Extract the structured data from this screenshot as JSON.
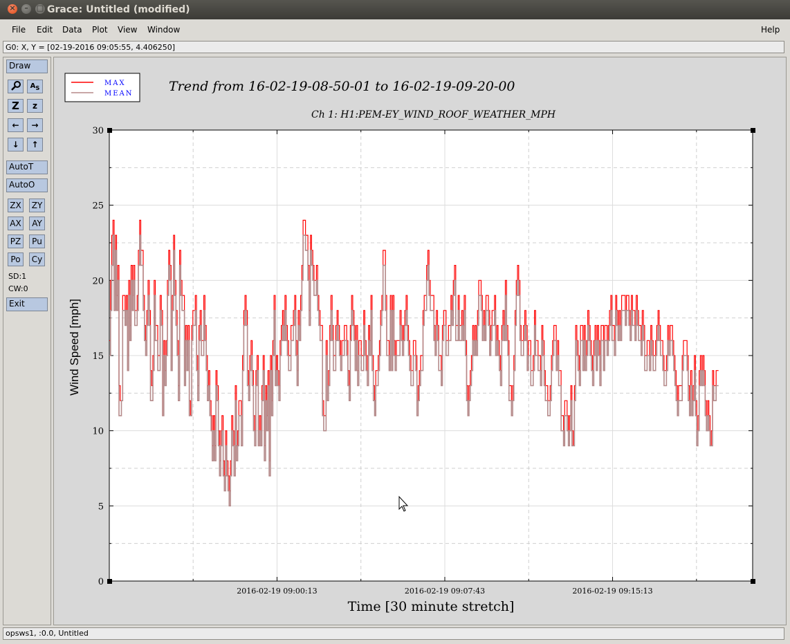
{
  "window": {
    "title": "Grace: Untitled (modified)"
  },
  "menubar": {
    "items": [
      "File",
      "Edit",
      "Data",
      "Plot",
      "View",
      "Window"
    ],
    "help": "Help"
  },
  "locator": {
    "text": "G0: X, Y = [02-19-2016 09:05:55, 4.406250]"
  },
  "toolbar": {
    "draw": "Draw",
    "autot": "AutoT",
    "autoo": "AutoO",
    "zx": "ZX",
    "zy": "ZY",
    "ax": "AX",
    "ay": "AY",
    "pz": "PZ",
    "pu": "Pu",
    "po": "Po",
    "cy": "Cy",
    "sd": "SD:1",
    "cw": "CW:0",
    "exit": "Exit"
  },
  "status": {
    "text": "opsws1, :0.0, Untitled"
  },
  "chart_data": {
    "type": "line",
    "title": "Trend from 16-02-19-08-50-01 to 16-02-19-09-20-00",
    "subtitle": "Ch 1: H1:PEM-EY_WIND_ROOF_WEATHER_MPH",
    "xlabel": "Time [30 minute stretch]",
    "ylabel": "Wind Speed [mph]",
    "ylim": [
      0,
      30
    ],
    "yticks": [
      0,
      5,
      10,
      15,
      20,
      25,
      30
    ],
    "xticks": [
      "2016-02-19 09:00:13",
      "2016-02-19 09:07:43",
      "2016-02-19 09:15:13"
    ],
    "grid": true,
    "legend": "top-left",
    "colors": {
      "max": "#ff0000",
      "mean": "#b58a8a"
    },
    "series": [
      {
        "name": "MAX",
        "values": [
          16,
          20,
          23,
          24,
          20,
          23,
          19,
          21,
          13,
          12,
          12,
          19,
          19,
          18,
          19,
          15,
          20,
          17,
          21,
          19,
          21,
          18,
          18,
          19,
          22,
          24,
          22,
          22,
          19,
          17,
          16,
          18,
          20,
          18,
          14,
          13,
          15,
          20,
          17,
          17,
          15,
          15,
          19,
          18,
          11,
          16,
          14,
          16,
          20,
          22,
          21,
          15,
          19,
          23,
          20,
          18,
          16,
          13,
          22,
          20,
          19,
          19,
          14,
          17,
          15,
          17,
          12,
          11,
          17,
          18,
          18,
          19,
          15,
          13,
          17,
          18,
          16,
          16,
          19,
          17,
          15,
          13,
          14,
          12,
          11,
          9,
          11,
          9,
          14,
          13,
          10,
          8,
          10,
          11,
          8,
          7,
          10,
          8,
          7,
          6,
          8,
          11,
          10,
          7,
          13,
          9,
          10,
          12,
          12,
          9,
          15,
          18,
          19,
          18,
          14,
          13,
          15,
          16,
          14,
          11,
          10,
          14,
          15,
          9,
          11,
          10,
          13,
          15,
          9,
          13,
          11,
          14,
          8,
          15,
          12,
          16,
          19,
          14,
          15,
          14,
          13,
          16,
          17,
          18,
          17,
          19,
          17,
          16,
          15,
          15,
          17,
          17,
          18,
          19,
          16,
          14,
          18,
          17,
          19,
          21,
          24,
          24,
          23,
          23,
          21,
          18,
          23,
          22,
          21,
          20,
          20,
          21,
          19,
          18,
          17,
          17,
          12,
          11,
          11,
          16,
          13,
          14,
          17,
          19,
          17,
          15,
          15,
          17,
          18,
          17,
          16,
          15,
          16,
          16,
          17,
          17,
          16,
          14,
          13,
          17,
          19,
          18,
          17,
          15,
          17,
          14,
          16,
          16,
          15,
          15,
          18,
          16,
          15,
          14,
          17,
          16,
          19,
          15,
          13,
          12,
          14,
          14,
          15,
          16,
          18,
          19,
          22,
          22,
          19,
          16,
          16,
          15,
          19,
          15,
          19,
          16,
          15,
          16,
          16,
          16,
          18,
          17,
          16,
          17,
          18,
          19,
          17,
          16,
          15,
          14,
          14,
          16,
          16,
          15,
          12,
          13,
          14,
          15,
          15,
          18,
          19,
          19,
          21,
          22,
          20,
          19,
          19,
          19,
          17,
          16,
          18,
          17,
          15,
          15,
          14,
          17,
          18,
          18,
          16,
          16,
          17,
          17,
          19,
          18,
          20,
          21,
          17,
          17,
          19,
          17,
          17,
          18,
          17,
          19,
          16,
          13,
          12,
          13,
          14,
          15,
          17,
          16,
          17,
          16,
          18,
          20,
          20,
          19,
          17,
          18,
          17,
          19,
          19,
          18,
          16,
          17,
          18,
          18,
          19,
          16,
          17,
          16,
          15,
          14,
          17,
          18,
          17,
          20,
          17,
          16,
          13,
          13,
          12,
          13,
          15,
          18,
          20,
          21,
          20,
          17,
          16,
          16,
          17,
          18,
          17,
          15,
          16,
          16,
          14,
          14,
          15,
          18,
          16,
          16,
          15,
          15,
          14,
          17,
          16,
          14,
          13,
          13,
          12,
          12,
          13,
          15,
          16,
          17,
          17,
          15,
          16,
          14,
          14,
          11,
          11,
          10,
          12,
          12,
          11,
          10,
          11,
          13,
          10,
          9,
          13,
          17,
          16,
          15,
          14,
          17,
          17,
          15,
          17,
          15,
          16,
          18,
          17,
          16,
          15,
          14,
          16,
          17,
          15,
          17,
          16,
          14,
          17,
          17,
          15,
          17,
          17,
          16,
          17,
          18,
          19,
          17,
          17,
          16,
          19,
          18,
          17,
          18,
          17,
          19,
          19,
          19,
          18,
          19,
          19,
          18,
          17,
          19,
          18,
          18,
          17,
          19,
          18,
          17,
          17,
          16,
          18,
          17,
          15,
          15,
          16,
          16,
          15,
          17,
          16,
          15,
          15,
          16,
          17,
          18,
          17,
          16,
          16,
          15,
          14,
          14,
          15,
          17,
          16,
          17,
          17,
          16,
          15,
          14,
          13,
          12,
          13,
          13,
          13,
          15,
          16,
          16,
          16,
          15,
          13,
          12,
          14,
          12,
          13,
          15,
          12,
          10,
          11,
          14,
          15,
          14,
          15,
          14,
          12,
          11,
          12,
          11,
          9,
          10,
          14,
          13,
          13,
          14,
          14
        ]
      },
      {
        "name": "MEAN",
        "values": [
          15,
          18,
          21,
          23,
          18,
          22,
          18,
          20,
          11,
          11,
          12,
          18,
          18,
          17,
          18,
          14,
          19,
          16,
          20,
          18,
          20,
          17,
          17,
          18,
          21,
          23,
          21,
          21,
          18,
          16,
          15,
          17,
          19,
          17,
          12,
          12,
          14,
          19,
          16,
          16,
          14,
          14,
          18,
          17,
          11,
          15,
          13,
          15,
          19,
          21,
          20,
          14,
          18,
          22,
          19,
          17,
          15,
          12,
          21,
          19,
          18,
          18,
          13,
          16,
          14,
          16,
          11,
          11,
          16,
          17,
          17,
          18,
          14,
          12,
          16,
          17,
          15,
          15,
          18,
          16,
          14,
          12,
          13,
          11,
          10,
          8,
          10,
          8,
          13,
          12,
          9,
          7,
          9,
          10,
          7,
          6,
          9,
          7,
          6,
          5,
          7,
          10,
          9,
          7,
          12,
          8,
          9,
          11,
          11,
          9,
          14,
          17,
          18,
          17,
          13,
          12,
          14,
          15,
          13,
          10,
          9,
          13,
          14,
          9,
          10,
          9,
          12,
          14,
          8,
          12,
          10,
          13,
          7,
          14,
          11,
          15,
          18,
          13,
          14,
          13,
          12,
          15,
          16,
          17,
          16,
          18,
          16,
          15,
          14,
          14,
          16,
          16,
          17,
          18,
          15,
          13,
          17,
          16,
          18,
          20,
          23,
          23,
          22,
          22,
          20,
          17,
          22,
          21,
          20,
          19,
          19,
          20,
          18,
          17,
          16,
          16,
          11,
          10,
          10,
          15,
          12,
          13,
          16,
          18,
          16,
          14,
          14,
          16,
          17,
          16,
          15,
          14,
          15,
          15,
          16,
          16,
          15,
          13,
          12,
          16,
          18,
          17,
          16,
          14,
          16,
          13,
          15,
          15,
          14,
          14,
          17,
          15,
          14,
          13,
          16,
          15,
          18,
          14,
          12,
          11,
          13,
          13,
          14,
          15,
          17,
          18,
          21,
          21,
          18,
          15,
          15,
          14,
          18,
          14,
          18,
          15,
          14,
          15,
          15,
          15,
          17,
          16,
          15,
          16,
          17,
          18,
          16,
          15,
          14,
          13,
          13,
          15,
          15,
          14,
          11,
          12,
          13,
          14,
          14,
          17,
          18,
          18,
          20,
          21,
          19,
          18,
          18,
          18,
          16,
          15,
          17,
          16,
          14,
          14,
          13,
          16,
          17,
          17,
          15,
          15,
          16,
          16,
          18,
          17,
          19,
          20,
          16,
          16,
          18,
          16,
          16,
          17,
          16,
          18,
          15,
          12,
          11,
          12,
          13,
          14,
          16,
          15,
          16,
          15,
          17,
          19,
          19,
          18,
          16,
          17,
          16,
          18,
          18,
          17,
          15,
          16,
          17,
          17,
          18,
          15,
          16,
          15,
          14,
          13,
          16,
          17,
          16,
          19,
          16,
          15,
          12,
          12,
          11,
          12,
          14,
          17,
          19,
          20,
          19,
          16,
          15,
          15,
          16,
          17,
          16,
          14,
          15,
          15,
          13,
          13,
          14,
          17,
          15,
          15,
          14,
          14,
          13,
          16,
          15,
          13,
          12,
          12,
          11,
          11,
          12,
          14,
          15,
          16,
          16,
          14,
          15,
          13,
          13,
          10,
          10,
          9,
          11,
          11,
          10,
          9,
          10,
          12,
          9,
          9,
          12,
          16,
          15,
          14,
          13,
          16,
          16,
          14,
          16,
          14,
          15,
          17,
          16,
          15,
          14,
          13,
          15,
          16,
          14,
          16,
          15,
          13,
          16,
          16,
          14,
          16,
          16,
          15,
          16,
          17,
          18,
          16,
          16,
          15,
          18,
          17,
          16,
          17,
          16,
          18,
          18,
          18,
          17,
          18,
          18,
          17,
          16,
          18,
          17,
          17,
          16,
          18,
          17,
          16,
          16,
          15,
          17,
          16,
          14,
          14,
          15,
          15,
          14,
          16,
          15,
          14,
          14,
          15,
          16,
          17,
          16,
          15,
          15,
          14,
          13,
          13,
          14,
          16,
          15,
          16,
          16,
          15,
          14,
          13,
          12,
          11,
          12,
          12,
          12,
          14,
          15,
          15,
          15,
          14,
          12,
          11,
          13,
          11,
          12,
          14,
          11,
          9,
          10,
          13,
          14,
          13,
          14,
          13,
          11,
          10,
          11,
          10,
          9,
          9,
          13,
          12,
          12,
          13,
          13
        ]
      }
    ]
  }
}
